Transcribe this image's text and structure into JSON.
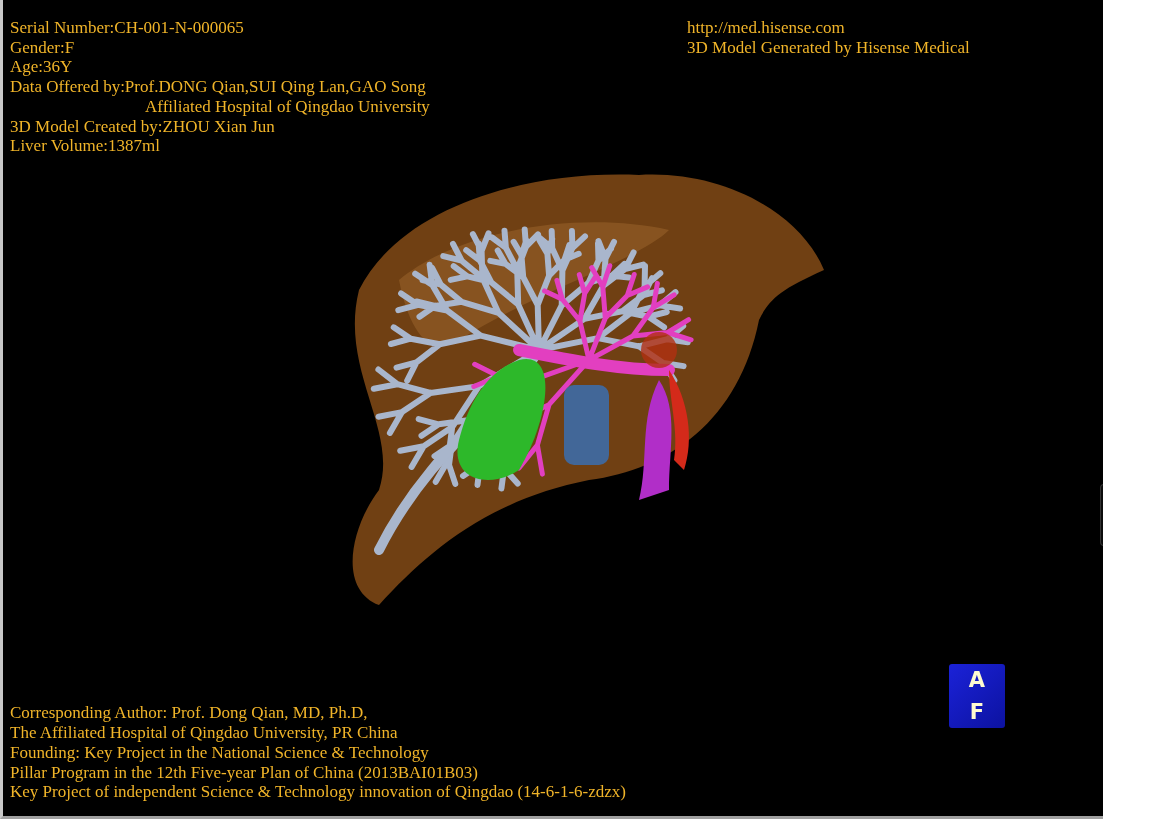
{
  "patient_info": [
    {
      "kind": "line",
      "text": "Serial Number:CH-001-N-000065"
    },
    {
      "kind": "line",
      "text": "Gender:F"
    },
    {
      "kind": "line",
      "text": "Age:36Y"
    },
    {
      "kind": "line",
      "text": "Data Offered by:Prof.DONG Qian,SUI Qing Lan,GAO Song"
    },
    {
      "kind": "continuation",
      "text": "Affiliated Hospital of Qingdao University"
    },
    {
      "kind": "line",
      "text": "3D Model Created by:ZHOU Xian Jun"
    },
    {
      "kind": "line",
      "text": "Liver Volume:1387ml"
    }
  ],
  "header_right": [
    "http://med.hisense.com",
    "3D Model Generated by Hisense Medical"
  ],
  "credits": [
    "Corresponding Author: Prof. Dong Qian, MD, Ph.D,",
    "The Affiliated Hospital of Qingdao University, PR China",
    "Founding: Key Project in the National Science & Technology",
    "Pillar Program in the 12th Five-year Plan of China (2013BAI01B03)",
    "Key Project of independent Science & Technology innovation of Qingdao (14-6-1-6-zdzx)"
  ],
  "orientation_cube": {
    "top": "A",
    "front": "F"
  }
}
